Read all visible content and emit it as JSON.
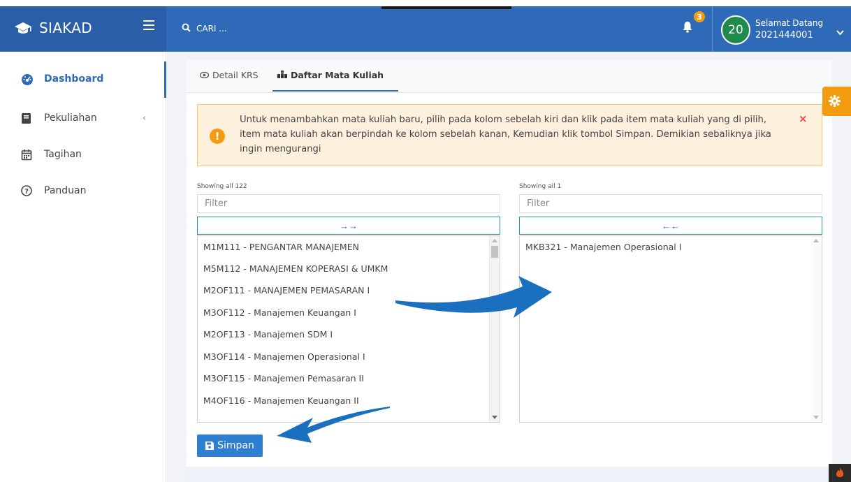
{
  "brand": {
    "name": "SIAKAD"
  },
  "search": {
    "placeholder": "CARI ..."
  },
  "notifications": {
    "count": "3"
  },
  "user": {
    "avatar_text": "20",
    "greeting": "Selamat Datang",
    "nim": "2021444001"
  },
  "sidebar": {
    "items": [
      {
        "label": "Dashboard",
        "icon": "tachometer-icon"
      },
      {
        "label": "Pekuliahan",
        "icon": "book-icon"
      },
      {
        "label": "Tagihan",
        "icon": "calendar-icon"
      },
      {
        "label": "Panduan",
        "icon": "question-circle-icon"
      }
    ]
  },
  "tabs": [
    {
      "label": "Detail KRS",
      "icon": "eye-icon"
    },
    {
      "label": "Daftar Mata Kuliah",
      "icon": "sitemap-icon"
    }
  ],
  "alert": {
    "text": "Untuk menambahkan mata kuliah baru, pilih pada kolom sebelah kiri dan klik pada item mata kuliah yang di pilih, item mata kuliah akan berpindah ke kolom sebelah kanan, Kemudian klik tombol Simpan. Demikian sebaliknya jika ingin mengurangi",
    "close": "×"
  },
  "dual_list": {
    "left": {
      "showing": "Showing all 122",
      "filter_placeholder": "Filter",
      "move_button": "→→",
      "items": [
        "M1M111 - PENGANTAR MANAJEMEN",
        "M5M112 - MANAJEMEN KOPERASI & UMKM",
        "M2OF111 - MANAJEMEN PEMASARAN I",
        "M3OF112 - Manajemen Keuangan I",
        "M2OF113 - Manajemen SDM I",
        "M3OF114 - Manajemen Operasional I",
        "M3OF115 - Manajemen Pemasaran II",
        "M4OF116 - Manajemen Keuangan II"
      ]
    },
    "right": {
      "showing": "Showing all 1",
      "filter_placeholder": "Filter",
      "move_button": "←←",
      "items": [
        "MKB321 - Manajemen Operasional I"
      ]
    }
  },
  "save_button": {
    "label": "Simpan"
  },
  "colors": {
    "primary": "#2f6ab8",
    "warning": "#f39c12",
    "annotation_arrow": "#1a6fbf"
  }
}
